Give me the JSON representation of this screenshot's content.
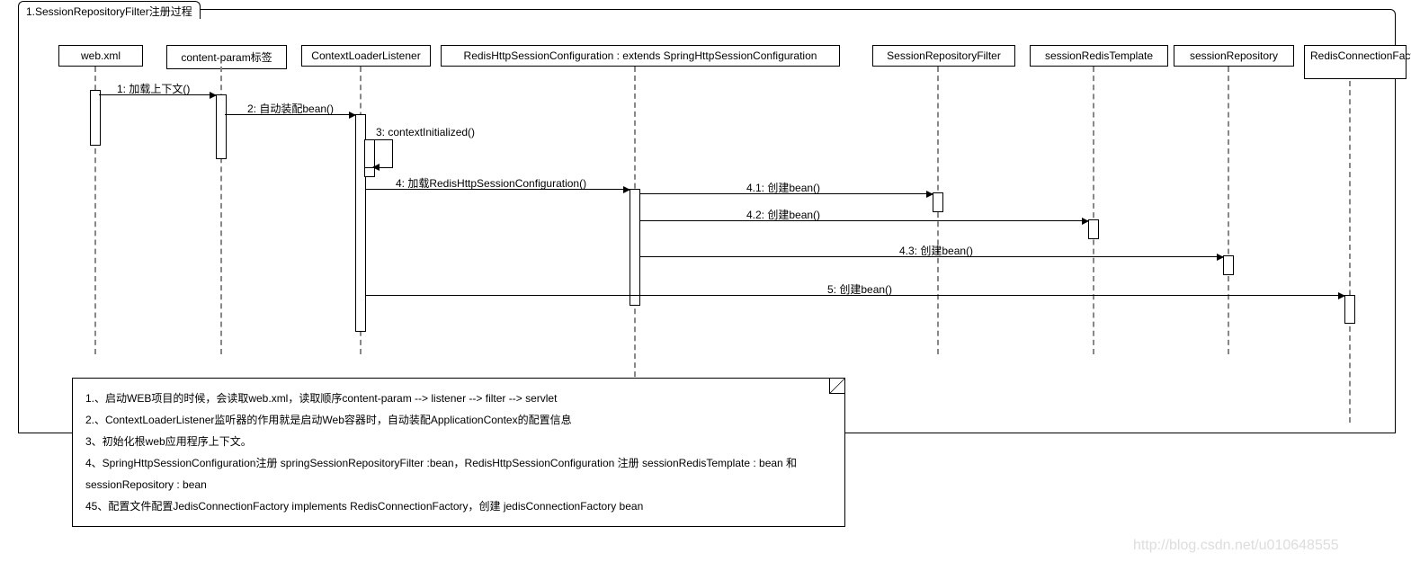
{
  "frame": {
    "title": "1.SessionRepositoryFilter注册过程"
  },
  "participants": {
    "p1": "web.xml",
    "p2": "content-param标签",
    "p3": "ContextLoaderListener",
    "p4": "RedisHttpSessionConfiguration : extends SpringHttpSessionConfiguration",
    "p5": "SessionRepositoryFilter",
    "p6": "sessionRedisTemplate",
    "p7": "sessionRepository",
    "p8": "RedisConnectionFactory"
  },
  "messages": {
    "m1": "1: 加载上下文()",
    "m2": "2: 自动装配bean()",
    "m3": "3: contextInitialized()",
    "m4": "4: 加载RedisHttpSessionConfiguration()",
    "m41": "4.1: 创建bean()",
    "m42": "4.2: 创建bean()",
    "m43": "4.3: 创建bean()",
    "m5": "5: 创建bean()"
  },
  "note": {
    "l1": "1.、启动WEB项目的时候，会读取web.xml，读取顺序content-param --> listener --> filter --> servlet",
    "l2": "2.、ContextLoaderListener监听器的作用就是启动Web容器时，自动装配ApplicationContex的配置信息",
    "l3": "3、初始化根web应用程序上下文。",
    "l4": "4、SpringHttpSessionConfiguration注册 springSessionRepositoryFilter :bean，RedisHttpSessionConfiguration 注册 sessionRedisTemplate : bean 和 sessionRepository : bean",
    "l5": "45、配置文件配置JedisConnectionFactory implements RedisConnectionFactory，创建 jedisConnectionFactory bean"
  },
  "watermark": "http://blog.csdn.net/u010648555"
}
